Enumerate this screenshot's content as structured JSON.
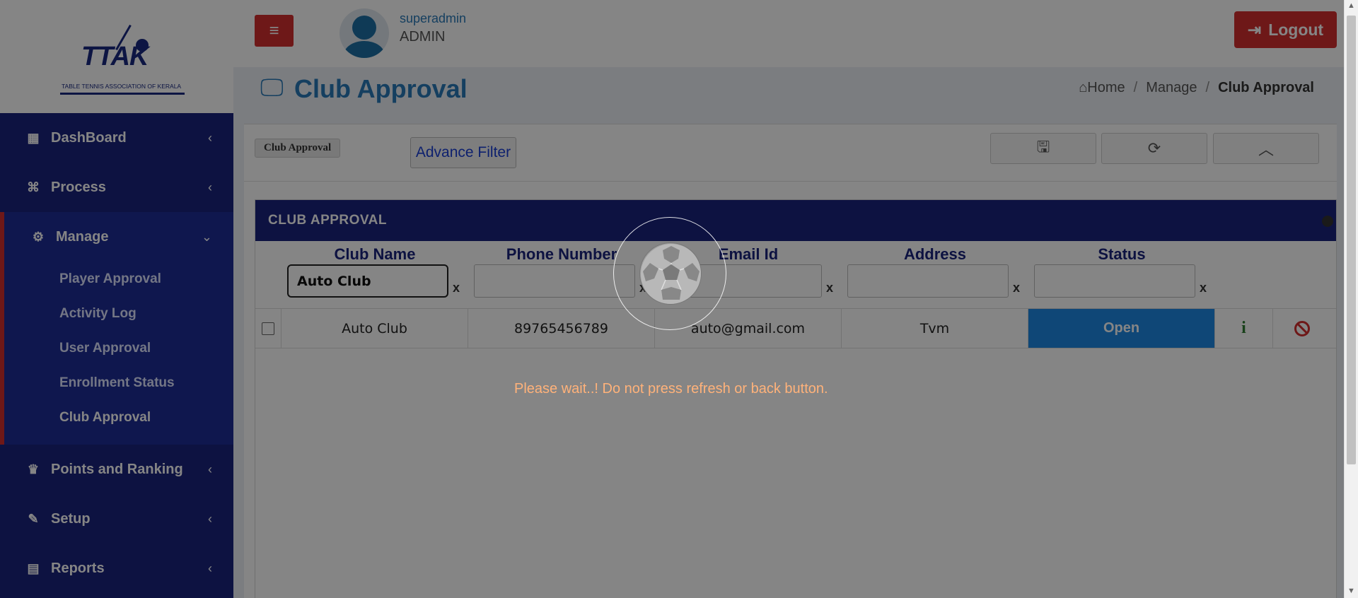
{
  "logo": {
    "initials": "TTAK",
    "subtitle": "TABLE TENNIS ASSOCIATION OF KERALA"
  },
  "sidebar": {
    "items": [
      {
        "label": "DashBoard",
        "icon": "windows-icon"
      },
      {
        "label": "Process",
        "icon": "gamepad-icon"
      },
      {
        "label": "Manage",
        "icon": "gear-icon",
        "expanded": true
      },
      {
        "label": "Points and Ranking",
        "icon": "trophy-icon"
      },
      {
        "label": "Setup",
        "icon": "wrench-icon"
      },
      {
        "label": "Reports",
        "icon": "pdf-icon"
      }
    ],
    "manage_subitems": [
      {
        "label": "Player Approval"
      },
      {
        "label": "Activity Log"
      },
      {
        "label": "User Approval"
      },
      {
        "label": "Enrollment Status"
      },
      {
        "label": "Club Approval",
        "current": true
      }
    ]
  },
  "header": {
    "username": "superadmin",
    "role": "ADMIN",
    "logout_label": "Logout",
    "accent_color": "#d32f2f"
  },
  "page": {
    "title": "Club Approval",
    "breadcrumb": [
      "Home",
      "Manage",
      "Club Approval"
    ]
  },
  "toolbar": {
    "tag_label": "Club Approval",
    "advance_filter_label": "Advance Filter",
    "buttons": [
      "save-icon",
      "refresh-icon",
      "chevron-up-icon"
    ]
  },
  "grid": {
    "header": "CLUB APPROVAL",
    "columns": [
      "Club Name",
      "Phone Number",
      "Email Id",
      "Address",
      "Status"
    ],
    "filters": [
      "Auto Club",
      "",
      "",
      "",
      ""
    ],
    "clear_label": "x",
    "rows": [
      {
        "club_name": "Auto Club",
        "phone": "89765456789",
        "email": "auto@gmail.com",
        "address": "Tvm",
        "status": "Open"
      }
    ],
    "status_color": "#1e88e5"
  },
  "loading": {
    "message": "Please wait..! Do not press refresh or back button."
  }
}
